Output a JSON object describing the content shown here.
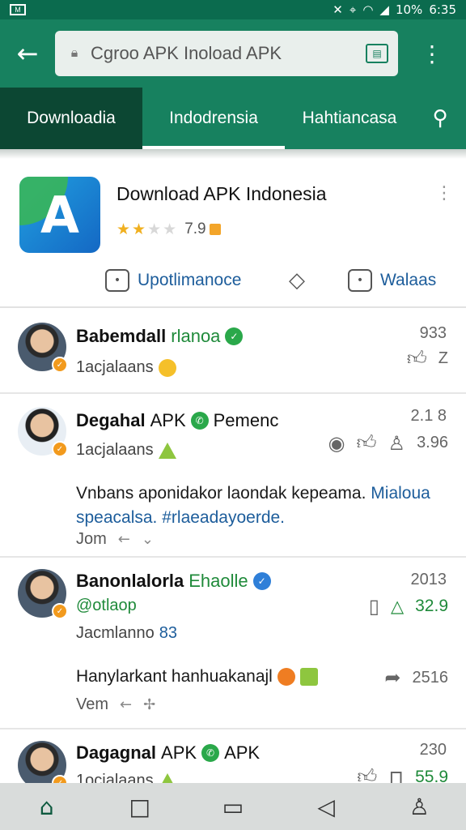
{
  "status_bar": {
    "battery": "10%",
    "time": "6:35"
  },
  "browser": {
    "url_text": "Cgrоo APK Inoload APK",
    "icons": {
      "back": "arrow-left-icon",
      "lock": "lock-icon",
      "tabs": "tab-switcher-icon",
      "menu": "kebab-menu-icon"
    }
  },
  "tabs": [
    {
      "label": "Downloadia"
    },
    {
      "label": "Indodrensia"
    },
    {
      "label": "Hahtiancasa"
    }
  ],
  "app": {
    "title": "Download APK Indonesia",
    "rating_value": "7.9",
    "stars_filled": 2,
    "stars_total": 5,
    "logo_letter": "A",
    "actions": [
      {
        "label": "Upotlimanoce"
      },
      {
        "label": ""
      },
      {
        "label": "Walaas"
      }
    ]
  },
  "comments": [
    {
      "name": "Babemdall",
      "name_extra": "rlanoa",
      "sub": "1acjalaans",
      "time": "933",
      "likes": "",
      "reply_count": "Z"
    },
    {
      "name": "Degahal",
      "name_extra": "APK",
      "name_tail": "Pemenc",
      "sub": "1acjalaans",
      "time": "2.1 8",
      "likes": "3.96",
      "body": "Vnbans aponidakor laondak kepeama.",
      "body_link": "Mialoua speacalsa. #rlaeadayoerde.",
      "foot": "Jom"
    },
    {
      "name": "Banonlalorla",
      "name_extra": "Ehaolle",
      "handle": "@otlaop",
      "sub": "Jacmlanno",
      "sub_num": "83",
      "time": "2013",
      "likes": "32.9",
      "body": "Hanylarkant hanhuakanajl",
      "share_count": "2516",
      "foot": "Vem"
    },
    {
      "name": "Dagagnal",
      "name_extra": "APK",
      "name_tail": "APK",
      "sub": "1ocjalaans",
      "time": "230",
      "likes": "55.9"
    }
  ]
}
